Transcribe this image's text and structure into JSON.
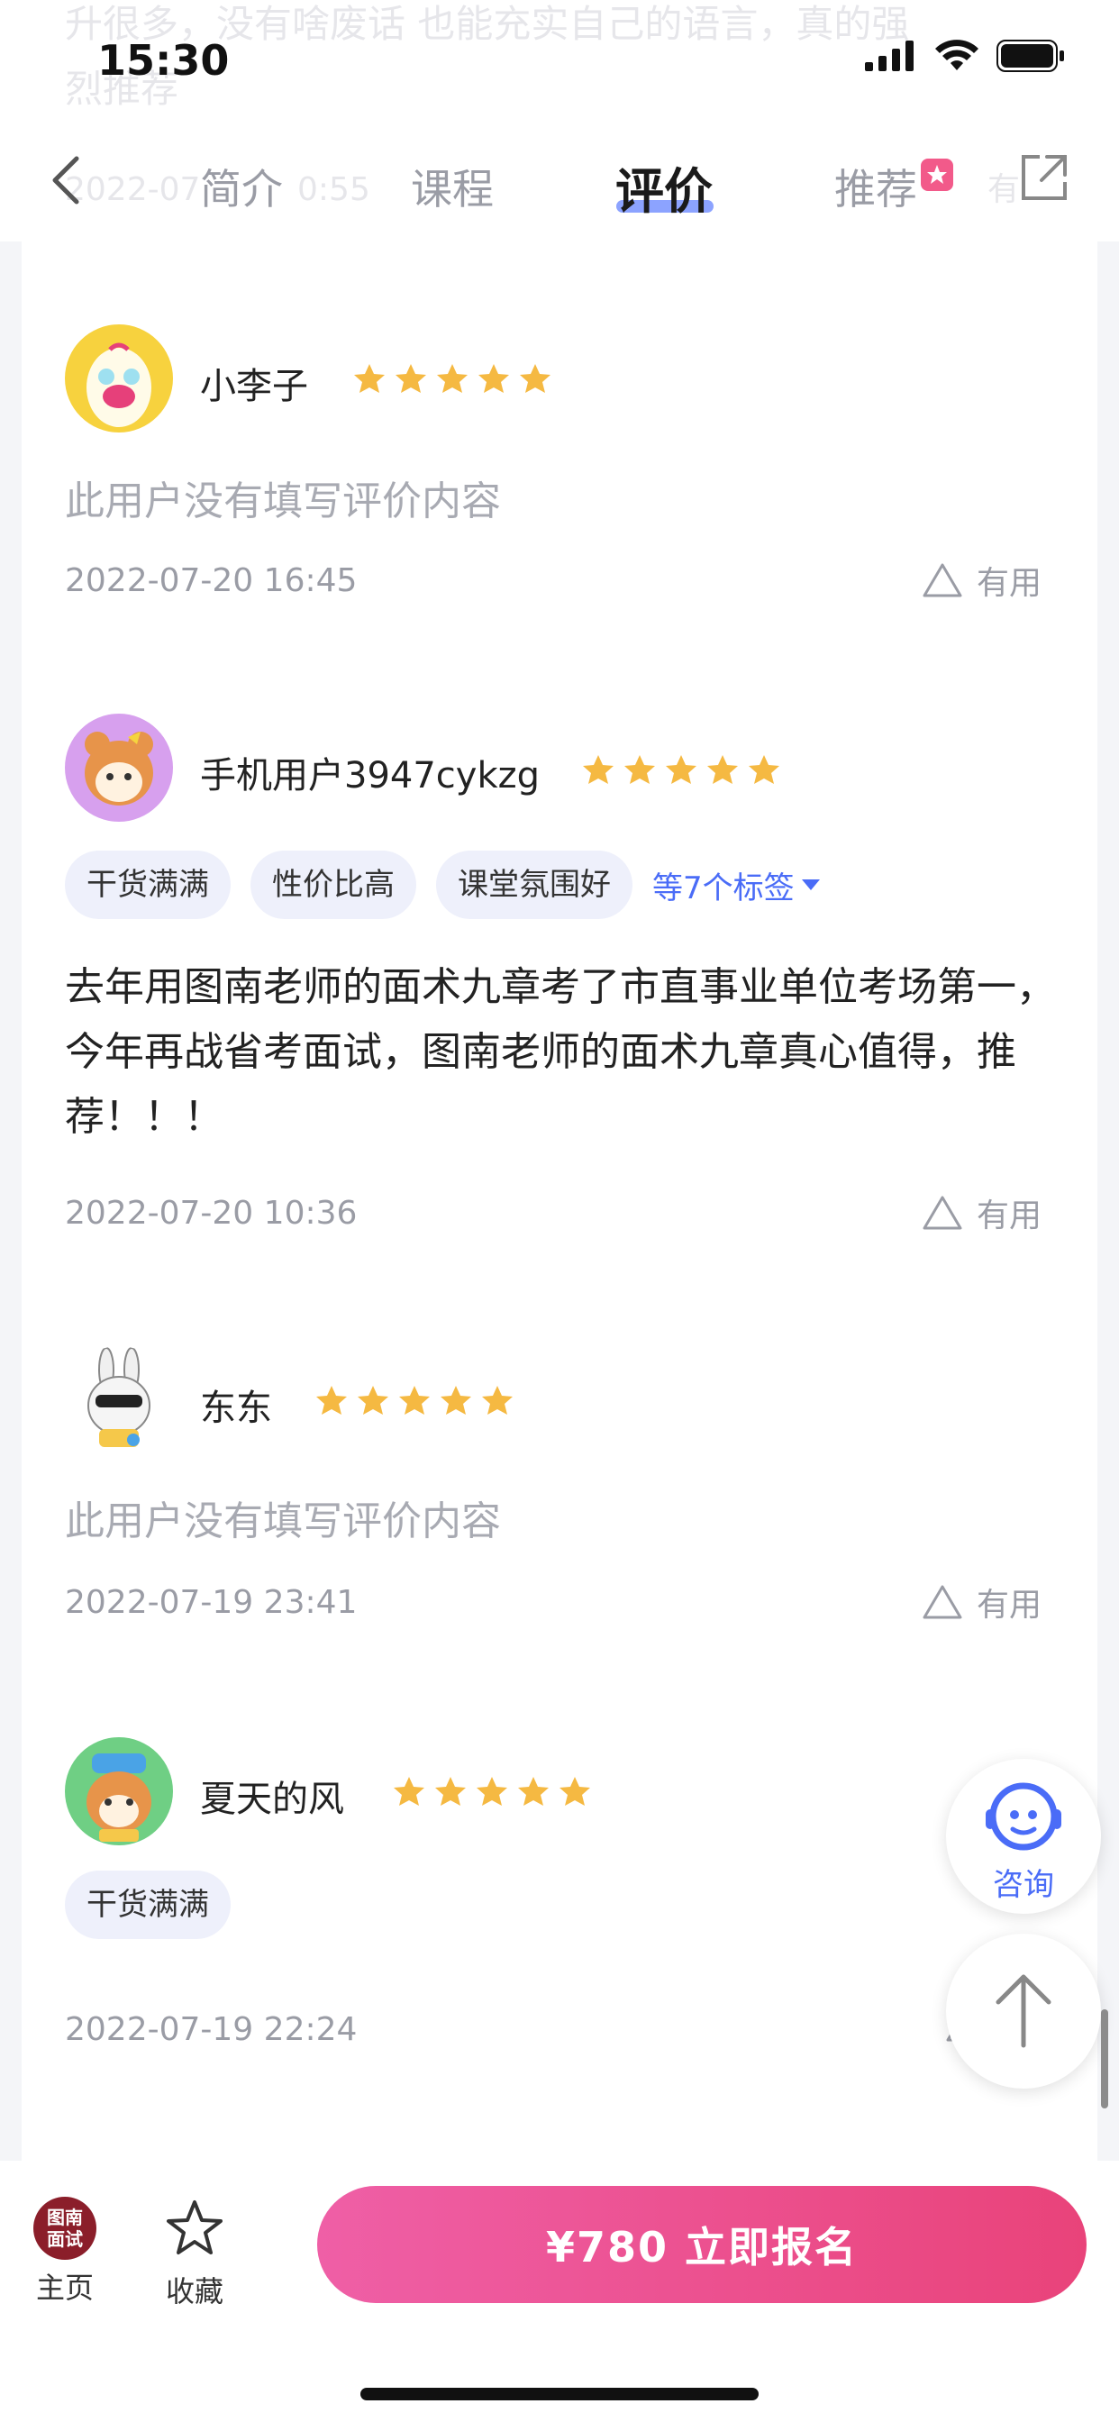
{
  "status_bar": {
    "time": "15:30"
  },
  "header": {
    "ghost_line1": "升很多，没有啥废话 也能充实自己的语言，真的强",
    "ghost_line2": "烈推荐",
    "ghost_date": "2022-07",
    "ghost_time": "0:55",
    "ghost_useful": "有",
    "tabs": [
      {
        "label": "简介"
      },
      {
        "label": "课程"
      },
      {
        "label": "评价"
      },
      {
        "label": "推荐"
      }
    ],
    "active_tab": "评价"
  },
  "reviews": [
    {
      "name": "小李子",
      "rating": 5,
      "text": "此用户没有填写评价内容",
      "date": "2022-07-20 16:45",
      "useful_label": "有用"
    },
    {
      "name": "手机用户3947cykzg",
      "rating": 5,
      "tags": [
        "干货满满",
        "性价比高",
        "课堂氛围好"
      ],
      "more_tags": "等7个标签",
      "text": "去年用图南老师的面术九章考了市直事业单位考场第一，今年再战省考面试，图南老师的面术九章真心值得，推荐！！！",
      "date": "2022-07-20 10:36",
      "useful_label": "有用"
    },
    {
      "name": "东东",
      "rating": 5,
      "text": "此用户没有填写评价内容",
      "date": "2022-07-19 23:41",
      "useful_label": "有用"
    },
    {
      "name": "夏天的风",
      "rating": 5,
      "tags": [
        "干货满满"
      ],
      "date": "2022-07-19 22:24"
    }
  ],
  "float": {
    "consult_label": "咨询"
  },
  "bottom_bar": {
    "logo_line1": "图南",
    "logo_line2": "面试",
    "home_label": "主页",
    "favorite_label": "收藏",
    "cta_label": "¥780  立即报名"
  },
  "colors": {
    "accent": "#4a6cf7",
    "cta_start": "#ef5fa6",
    "cta_end": "#e9437a",
    "star": "#f5b942"
  }
}
